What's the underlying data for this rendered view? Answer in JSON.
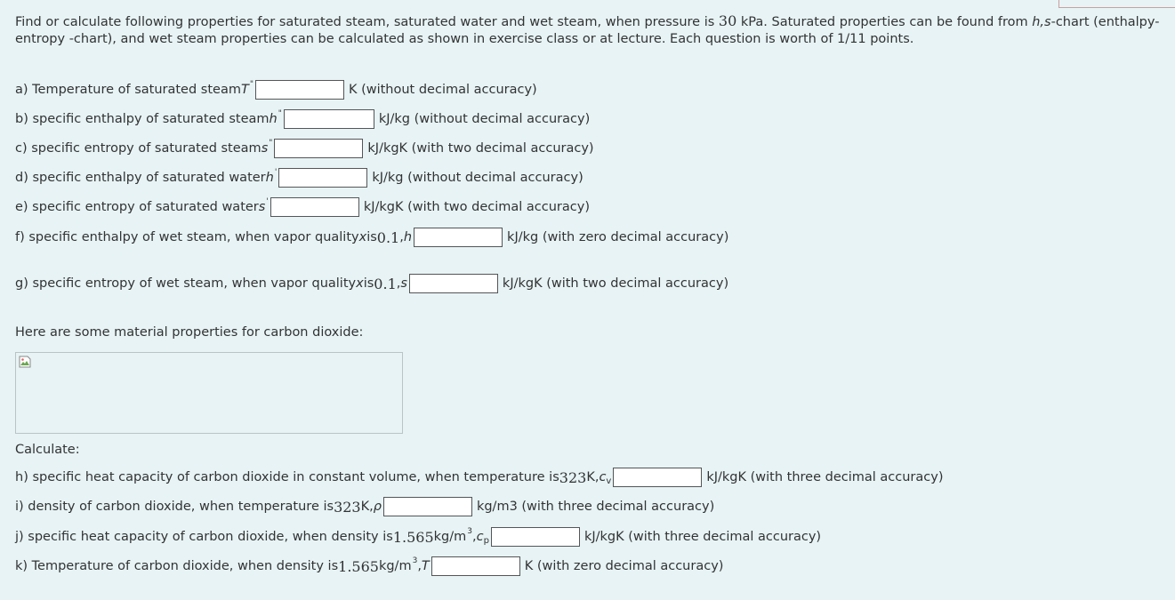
{
  "intro": {
    "part1": "Find or calculate following properties for saturated steam, saturated water and wet steam, when pressure is ",
    "pressure": "30",
    "part2": " kPa. Saturated properties can be found from ",
    "hs": "h,s",
    "part3": "-chart (enthalpy-entropy -chart), and wet steam properties can be calculated as shown in exercise class or at lecture. Each question is worth of 1/11 points."
  },
  "questions": {
    "a": {
      "label": "a) Temperature of saturated steam ",
      "symbol": "T",
      "mark": "\"",
      "unit": "K (without decimal accuracy)",
      "value": ""
    },
    "b": {
      "label": "b) specific enthalpy of saturated steam ",
      "symbol": "h",
      "mark": "\"",
      "unit": "kJ/kg (without decimal accuracy)",
      "value": ""
    },
    "c": {
      "label": "c) specific entropy of saturated steam ",
      "symbol": "s",
      "mark": "\"",
      "unit": "kJ/kgK (with two decimal accuracy)",
      "value": ""
    },
    "d": {
      "label": "d) specific enthalpy of saturated water ",
      "symbol": "h",
      "mark": "'",
      "unit": "kJ/kg (without decimal accuracy)",
      "value": ""
    },
    "e": {
      "label": "e) specific entropy of saturated water ",
      "symbol": "s",
      "mark": "'",
      "unit": "kJ/kgK (with two decimal accuracy)",
      "value": ""
    },
    "f": {
      "label1": "f) specific enthalpy of wet steam, when vapor quality ",
      "x": "x",
      "label2": " is ",
      "quality": "0.1",
      "label3": ", ",
      "symbol": "h",
      "unit": "kJ/kg (with zero decimal accuracy)",
      "value": ""
    },
    "g": {
      "label1": "g) specific entropy of wet steam, when vapor quality ",
      "x": "x",
      "label2": " is ",
      "quality": "0.1",
      "label3": ", ",
      "symbol": "s",
      "unit": "kJ/kgK (with two decimal accuracy)",
      "value": ""
    }
  },
  "co2_intro": "Here are some material properties for carbon dioxide:",
  "calculate": "Calculate:",
  "co2": {
    "h": {
      "label1": "h) specific heat capacity of carbon dioxide in constant volume, when temperature is ",
      "temp": "323",
      "label2": " K, ",
      "symbol": "c",
      "sub": "v",
      "unit": "kJ/kgK (with three decimal accuracy)",
      "value": ""
    },
    "i": {
      "label1": "i) density of carbon dioxide, when temperature is ",
      "temp": "323",
      "label2": " K, ",
      "symbol": "ρ",
      "unit": "kg/m3 (with three decimal accuracy)",
      "value": ""
    },
    "j": {
      "label1": "j) specific heat capacity of carbon dioxide,  when density is ",
      "density": "1.565",
      "label2": " kg/m",
      "exp": "3",
      "label3": ", ",
      "symbol": "c",
      "sub": "p",
      "unit": "kJ/kgK (with three decimal accuracy)",
      "value": ""
    },
    "k": {
      "label1": "k) Temperature of carbon dioxide, when density is ",
      "density": "1.565",
      "label2": " kg/m",
      "exp": "3",
      "label3": ", ",
      "symbol": "T",
      "unit": "K (with zero decimal accuracy)",
      "value": ""
    }
  },
  "colors": {
    "background": "#e7f3f5",
    "text": "#333333",
    "input_border": "#555555"
  },
  "icons": {
    "broken_image": "broken-image-icon"
  }
}
